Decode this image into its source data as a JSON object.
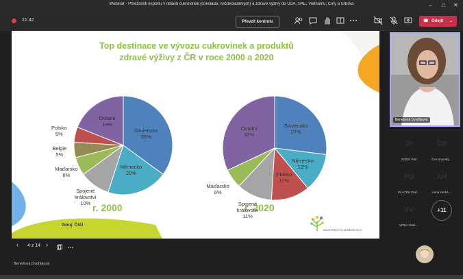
{
  "window": {
    "title": "Webinář - Příležitosti exportu v oblasti cukrovinek (čokoláda, nečokoládových) a zdravé výživy do USA, SAE, Vietnamu, Číny a Srbska",
    "minimize": "–",
    "maximize": "□",
    "close": "✕"
  },
  "toolbar": {
    "timer": "21:42",
    "take_control": "Převzít kontrolu",
    "leave": "Odejít"
  },
  "slide": {
    "title_line1": "Top destinace ve vývozu cukrovinek a produktů",
    "title_line2": "zdravé výživy z ČR v roce 2000 a 2020",
    "source": "Zdroj: ČSÚ",
    "ministry": "MINISTERSTVO ZEMĚDĚLSTVÍ",
    "year_2000": "r. 2000",
    "year_2020": "r. 2020"
  },
  "chart_data": [
    {
      "type": "pie",
      "title": "r. 2000",
      "slices": [
        {
          "name": "Slovensko",
          "value": 35,
          "label": "Slovensko\n35%",
          "color": "#4f81bd"
        },
        {
          "name": "Německo",
          "value": 20,
          "label": "Německo\n20%",
          "color": "#4bacc6"
        },
        {
          "name": "Spojené království",
          "value": 10,
          "label": "Spojené\nkrálovství\n10%",
          "color": "#a5a5a5"
        },
        {
          "name": "Maďarsko",
          "value": 6,
          "label": "Maďarsko\n6%",
          "color": "#9bbb59"
        },
        {
          "name": "Belgie",
          "value": 5,
          "label": "Belgie\n5%",
          "color": "#948a54"
        },
        {
          "name": "Polsko",
          "value": 5,
          "label": "Polsko\n5%",
          "color": "#c0504d"
        },
        {
          "name": "Ostatní",
          "value": 19,
          "label": "Ostatní\n19%",
          "color": "#8064a2"
        }
      ]
    },
    {
      "type": "pie",
      "title": "r. 2020",
      "slices": [
        {
          "name": "Slovensko",
          "value": 27,
          "label": "Slovensko\n27%",
          "color": "#4f81bd"
        },
        {
          "name": "Německo",
          "value": 12,
          "label": "Německo\n12%",
          "color": "#4bacc6"
        },
        {
          "name": "Polsko",
          "value": 12,
          "label": "Polsko\n12%",
          "color": "#c0504d"
        },
        {
          "name": "Spojené království",
          "value": 11,
          "label": "Spojené\nkrálovství\n11%",
          "color": "#a5a5a5"
        },
        {
          "name": "Maďarsko",
          "value": 6,
          "label": "Maďarsko\n6%",
          "color": "#9bbb59"
        },
        {
          "name": "Ostatní",
          "value": 32,
          "label": "Ostatní\n32%",
          "color": "#8064a2"
        }
      ]
    }
  ],
  "slide_nav": {
    "prev": "‹",
    "counter": "4 z 14",
    "next": "›"
  },
  "presenter": "Benešová Dvořáková",
  "video": {
    "name": "Benešová Dvořáková"
  },
  "participants": [
    {
      "initials": "JP",
      "name": "JEŽEK Petr",
      "color": "#b4bdf0"
    },
    {
      "initials": "ČR",
      "name": "Černohorský…",
      "color": "#f3c7b4"
    },
    {
      "initials": "PO",
      "name": "PLAČEK Ond…",
      "color": "#f4b8c4"
    },
    {
      "initials": "AH",
      "name": "Anna Hrubá…",
      "color": "#f1d0bf"
    },
    {
      "initials": "VV",
      "name": "VRBA Vladi…",
      "color": "#c7c9e0"
    },
    {
      "initials": "+11",
      "name": "",
      "color": "#444444"
    }
  ],
  "colors": {
    "accent": "#8bc53f",
    "leave": "#c4314b",
    "active_border": "#a6a7ff"
  }
}
